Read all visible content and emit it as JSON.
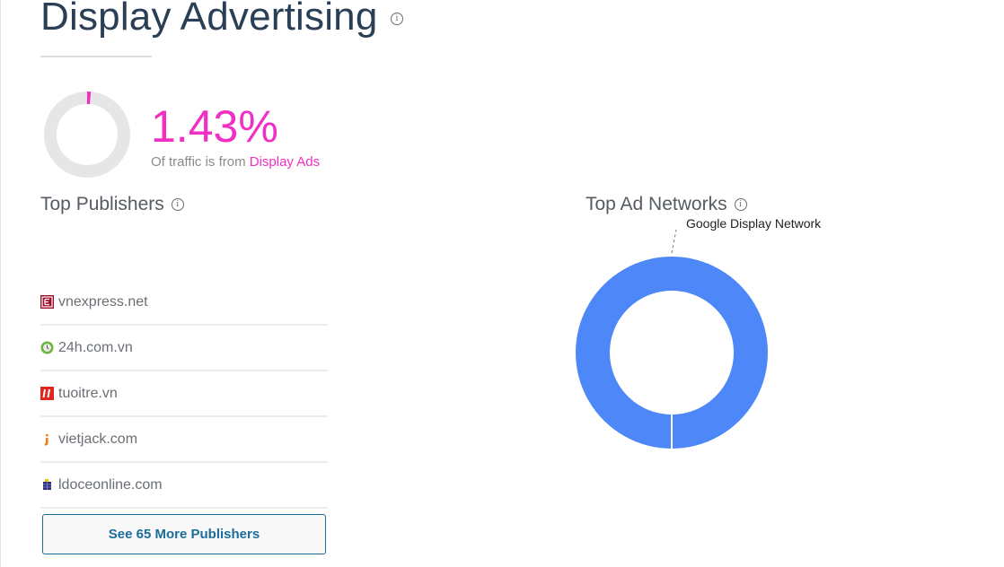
{
  "section": {
    "title": "Display Advertising",
    "info_icon": "info-icon"
  },
  "traffic_share": {
    "value_text": "1.43%",
    "value_fraction": 0.0143,
    "caption_prefix": "Of traffic is from ",
    "caption_accent": "Display Ads",
    "colors": {
      "accent": "#f12fc4",
      "track": "#e6e6e6"
    }
  },
  "top_publishers": {
    "title": "Top Publishers",
    "items": [
      {
        "name": "vnexpress.net",
        "icon": "vnexpress-favicon"
      },
      {
        "name": "24h.com.vn",
        "icon": "24h-favicon"
      },
      {
        "name": "tuoitre.vn",
        "icon": "tuoitre-favicon"
      },
      {
        "name": "vietjack.com",
        "icon": "vietjack-favicon"
      },
      {
        "name": "ldoceonline.com",
        "icon": "ldoceonline-favicon"
      }
    ],
    "see_more_label": "See 65 More Publishers"
  },
  "top_ad_networks": {
    "title": "Top Ad Networks",
    "chart_data": {
      "type": "pie",
      "title": "Top Ad Networks",
      "categories": [
        "Google Display Network"
      ],
      "values": [
        100
      ],
      "colors": [
        "#4d87f8"
      ],
      "donut": true
    }
  }
}
